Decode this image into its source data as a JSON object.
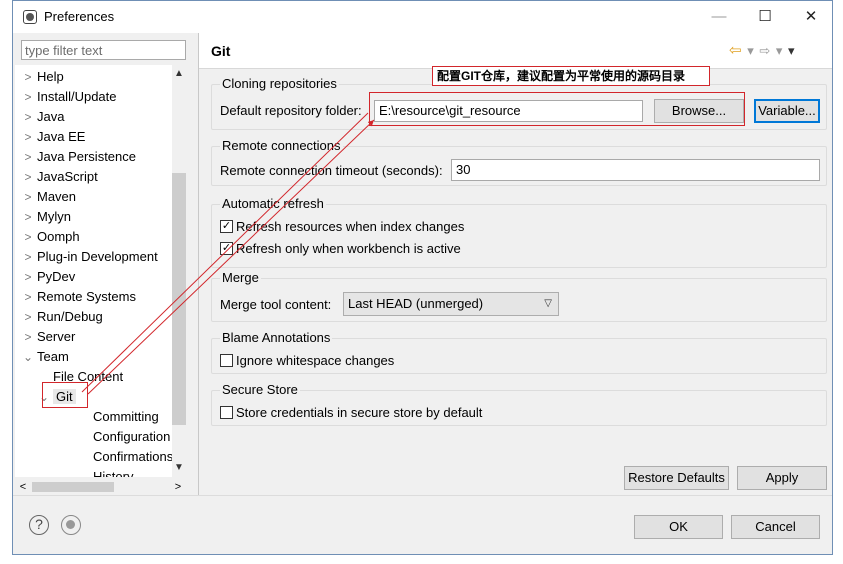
{
  "window": {
    "title": "Preferences",
    "controls": {
      "minimize": "—",
      "maximize": "☐",
      "close": "✕"
    }
  },
  "filter": {
    "placeholder": "type filter text",
    "value": ""
  },
  "tree": {
    "items": [
      {
        "label": "Help",
        "expander": ">",
        "level": 0
      },
      {
        "label": "Install/Update",
        "expander": ">",
        "level": 0
      },
      {
        "label": "Java",
        "expander": ">",
        "level": 0
      },
      {
        "label": "Java EE",
        "expander": ">",
        "level": 0
      },
      {
        "label": "Java Persistence",
        "expander": ">",
        "level": 0
      },
      {
        "label": "JavaScript",
        "expander": ">",
        "level": 0
      },
      {
        "label": "Maven",
        "expander": ">",
        "level": 0
      },
      {
        "label": "Mylyn",
        "expander": ">",
        "level": 0
      },
      {
        "label": "Oomph",
        "expander": ">",
        "level": 0
      },
      {
        "label": "Plug-in Development",
        "expander": ">",
        "level": 0
      },
      {
        "label": "PyDev",
        "expander": ">",
        "level": 0
      },
      {
        "label": "Remote Systems",
        "expander": ">",
        "level": 0
      },
      {
        "label": "Run/Debug",
        "expander": ">",
        "level": 0
      },
      {
        "label": "Server",
        "expander": ">",
        "level": 0
      },
      {
        "label": "Team",
        "expander": "v",
        "level": 0
      },
      {
        "label": "File Content",
        "expander": "",
        "level": 1
      },
      {
        "label": "Git",
        "expander": "v",
        "level": 1,
        "selected": true
      },
      {
        "label": "Committing",
        "expander": "",
        "level": 2
      },
      {
        "label": "Configuration",
        "expander": "",
        "level": 2
      },
      {
        "label": "Confirmations a",
        "expander": "",
        "level": 2
      },
      {
        "label": "History",
        "expander": "",
        "level": 2
      }
    ]
  },
  "page": {
    "title": "Git",
    "nav": {
      "back": "⇦",
      "back_menu": "▾",
      "forward": "⇨",
      "forward_menu": "▾",
      "view_menu": "▾"
    }
  },
  "cloning": {
    "title": "Cloning repositories",
    "folder_label": "Default repository folder:",
    "folder_value": "E:\\resource\\git_resource",
    "browse_label": "Browse...",
    "variable_label": "Variable..."
  },
  "remote": {
    "title": "Remote connections",
    "timeout_label": "Remote connection timeout (seconds):",
    "timeout_value": "30"
  },
  "refresh": {
    "title": "Automatic refresh",
    "index_label": "Refresh resources when index changes",
    "index_checked": true,
    "workbench_label": "Refresh only when workbench is active",
    "workbench_checked": true
  },
  "merge": {
    "title": "Merge",
    "tool_label": "Merge tool content:",
    "tool_value": "Last HEAD (unmerged)"
  },
  "blame": {
    "title": "Blame Annotations",
    "whitespace_label": "Ignore whitespace changes",
    "whitespace_checked": false
  },
  "secure": {
    "title": "Secure Store",
    "store_label": "Store credentials in secure store by default",
    "store_checked": false
  },
  "actions": {
    "restore_defaults": "Restore Defaults",
    "apply": "Apply",
    "ok": "OK",
    "cancel": "Cancel"
  },
  "footer": {
    "help_icon": "?"
  },
  "annotation": {
    "callout_text": "配置GIT仓库，建议配置为平常使用的源码目录",
    "color": "#d2262b"
  }
}
